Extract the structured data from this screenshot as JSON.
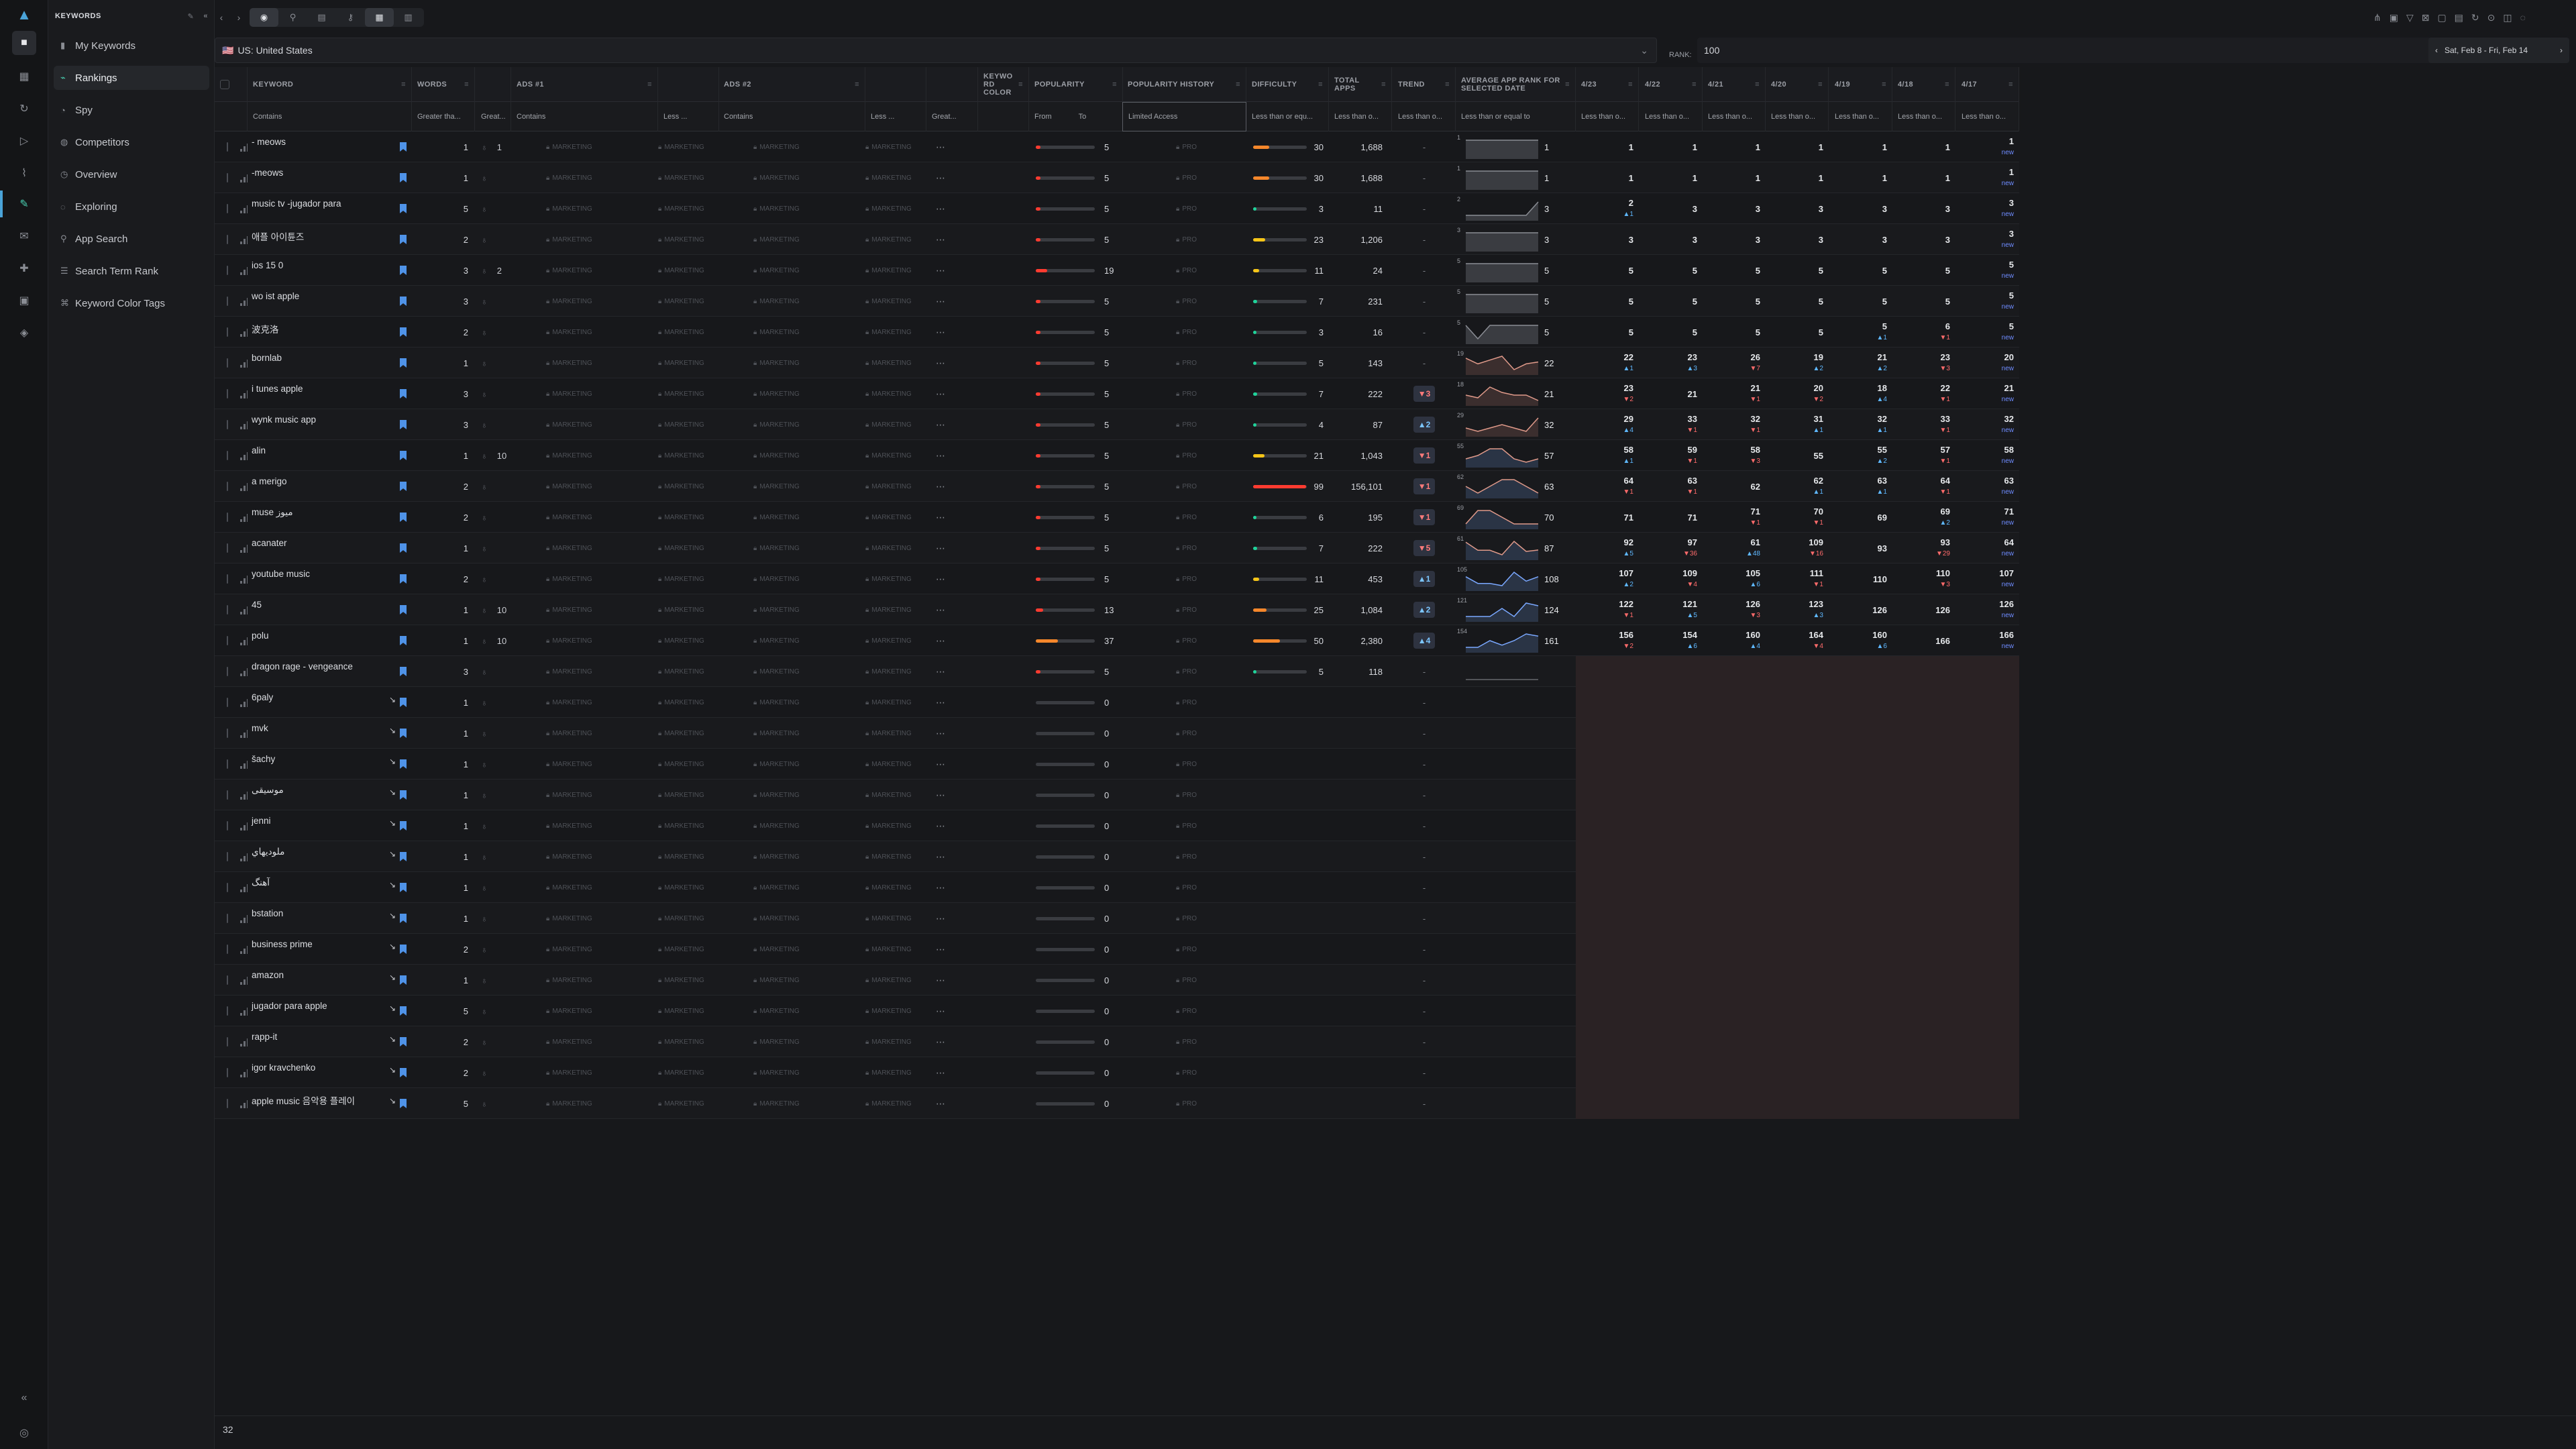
{
  "app": {
    "section": "KEYWORDS"
  },
  "nav": {
    "items": [
      {
        "label": "My Keywords",
        "icon": "bookmark-icon"
      },
      {
        "label": "Rankings",
        "icon": "rankings-icon",
        "selected": true
      },
      {
        "label": "Spy",
        "icon": "spy-icon"
      },
      {
        "label": "Competitors",
        "icon": "competitors-icon"
      },
      {
        "label": "Overview",
        "icon": "overview-icon"
      },
      {
        "label": "Exploring",
        "icon": "exploring-icon"
      },
      {
        "label": "App Search",
        "icon": "search-icon"
      },
      {
        "label": "Search Term Rank",
        "icon": "list-icon"
      },
      {
        "label": "Keyword Color Tags",
        "icon": "tag-icon"
      }
    ]
  },
  "filters": {
    "country": "US: United States",
    "rank_label": "RANK:",
    "rank_value": "100",
    "date_range": "Sat, Feb 8 - Fri, Feb 14"
  },
  "headers": {
    "keyword": "KEYWORD",
    "words": "WORDS",
    "ads1": "ADS #1",
    "ads2": "ADS #2",
    "color": "KEYWO RD COLOR",
    "popularity": "POPULARITY",
    "pop_history": "POPULARITY HISTORY",
    "difficulty": "DIFFICULTY",
    "total_apps": "TOTAL APPS",
    "trend": "TREND",
    "avg_rank": "AVERAGE APP RANK FOR SELECTED DATE",
    "d1": "4/23",
    "d2": "4/22",
    "d3": "4/21",
    "d4": "4/20",
    "d5": "4/19",
    "d6": "4/18",
    "d7": "4/17"
  },
  "subfilters": {
    "keyword": "Contains",
    "words": "Greater tha...",
    "hint": "Great...",
    "ads1": "Contains",
    "ads1b": "Less ...",
    "ads2": "Contains",
    "ads2b": "Less ...",
    "colorb": "Great...",
    "from": "From",
    "to": "To",
    "pop_history": "Limited Access",
    "difficulty": "Less than or equ...",
    "total_apps": "Less than o...",
    "trend": "Less than o...",
    "avg_rank": "Less than or equal to",
    "dates": "Less than o..."
  },
  "labels": {
    "market": "MARKETING",
    "pro": "PRO",
    "new": "new"
  },
  "rows": [
    {
      "kw": "- meows",
      "words": 1,
      "hint": "1",
      "pop": 5,
      "diff": 30,
      "apps": "1,688",
      "trend": "-",
      "avg": "1",
      "spark": "1",
      "r": [
        [
          "1",
          "",
          ""
        ],
        [
          "1",
          "",
          ""
        ],
        [
          "1",
          "",
          ""
        ],
        [
          "1",
          "",
          ""
        ],
        [
          "1",
          "",
          ""
        ],
        [
          "1",
          "",
          ""
        ],
        [
          "1",
          "new",
          "n"
        ]
      ]
    },
    {
      "kw": "-meows",
      "words": 1,
      "hint": "",
      "pop": 5,
      "diff": 30,
      "apps": "1,688",
      "trend": "-",
      "avg": "1",
      "spark": "1",
      "r": [
        [
          "1",
          "",
          ""
        ],
        [
          "1",
          "",
          ""
        ],
        [
          "1",
          "",
          ""
        ],
        [
          "1",
          "",
          ""
        ],
        [
          "1",
          "",
          ""
        ],
        [
          "1",
          "",
          ""
        ],
        [
          "1",
          "new",
          "n"
        ]
      ]
    },
    {
      "kw": "music tv -jugador para",
      "words": 5,
      "hint": "",
      "pop": 5,
      "diff": 3,
      "apps": "11",
      "trend": "-",
      "avg": "3",
      "spark": "2",
      "r": [
        [
          "2",
          "▲1",
          "u"
        ],
        [
          "3",
          "",
          ""
        ],
        [
          "3",
          "",
          ""
        ],
        [
          "3",
          "",
          ""
        ],
        [
          "3",
          "",
          ""
        ],
        [
          "3",
          "",
          ""
        ],
        [
          "3",
          "new",
          "n"
        ]
      ]
    },
    {
      "kw": "애플 아이튠즈",
      "words": 2,
      "hint": "",
      "pop": 5,
      "diff": 23,
      "apps": "1,206",
      "trend": "-",
      "avg": "3",
      "spark": "3",
      "r": [
        [
          "3",
          "",
          ""
        ],
        [
          "3",
          "",
          ""
        ],
        [
          "3",
          "",
          ""
        ],
        [
          "3",
          "",
          ""
        ],
        [
          "3",
          "",
          ""
        ],
        [
          "3",
          "",
          ""
        ],
        [
          "3",
          "new",
          "n"
        ]
      ]
    },
    {
      "kw": "ios 15 0",
      "words": 3,
      "hint": "2",
      "pop": 19,
      "diff": 11,
      "apps": "24",
      "trend": "-",
      "avg": "5",
      "spark": "5",
      "r": [
        [
          "5",
          "",
          ""
        ],
        [
          "5",
          "",
          ""
        ],
        [
          "5",
          "",
          ""
        ],
        [
          "5",
          "",
          ""
        ],
        [
          "5",
          "",
          ""
        ],
        [
          "5",
          "",
          ""
        ],
        [
          "5",
          "new",
          "n"
        ]
      ]
    },
    {
      "kw": "wo ist apple",
      "words": 3,
      "hint": "",
      "pop": 5,
      "diff": 7,
      "apps": "231",
      "trend": "-",
      "avg": "5",
      "spark": "5",
      "r": [
        [
          "5",
          "",
          ""
        ],
        [
          "5",
          "",
          ""
        ],
        [
          "5",
          "",
          ""
        ],
        [
          "5",
          "",
          ""
        ],
        [
          "5",
          "",
          ""
        ],
        [
          "5",
          "",
          ""
        ],
        [
          "5",
          "new",
          "n"
        ]
      ]
    },
    {
      "kw": "波克洛",
      "words": 2,
      "hint": "",
      "pop": 5,
      "diff": 3,
      "apps": "16",
      "trend": "-",
      "avg": "5",
      "spark": "5",
      "r": [
        [
          "5",
          "",
          ""
        ],
        [
          "5",
          "",
          ""
        ],
        [
          "5",
          "",
          ""
        ],
        [
          "5",
          "",
          ""
        ],
        [
          "5",
          "▲1",
          "u"
        ],
        [
          "6",
          "▼1",
          "d"
        ],
        [
          "5",
          "new",
          "n"
        ]
      ]
    },
    {
      "kw": "bornlab",
      "words": 1,
      "hint": "",
      "pop": 5,
      "diff": 5,
      "apps": "143",
      "trend": "-",
      "avg": "22",
      "spark": "19",
      "r": [
        [
          "22",
          "▲1",
          "u"
        ],
        [
          "23",
          "▲3",
          "u"
        ],
        [
          "26",
          "▼7",
          "d"
        ],
        [
          "19",
          "▲2",
          "u"
        ],
        [
          "21",
          "▲2",
          "u"
        ],
        [
          "23",
          "▼3",
          "d"
        ],
        [
          "20",
          "new",
          "n"
        ]
      ]
    },
    {
      "kw": "i tunes apple",
      "words": 3,
      "hint": "",
      "pop": 5,
      "diff": 7,
      "apps": "222",
      "trend": "▼3",
      "avg": "21",
      "spark": "18",
      "r": [
        [
          "23",
          "▼2",
          "d"
        ],
        [
          "21",
          "",
          ""
        ],
        [
          "21",
          "▼1",
          "d"
        ],
        [
          "20",
          "▼2",
          "d"
        ],
        [
          "18",
          "▲4",
          "u"
        ],
        [
          "22",
          "▼1",
          "d"
        ],
        [
          "21",
          "new",
          "n"
        ]
      ]
    },
    {
      "kw": "wynk music app",
      "words": 3,
      "hint": "",
      "pop": 5,
      "diff": 4,
      "apps": "87",
      "trend": "▲2",
      "avg": "32",
      "spark": "29",
      "r": [
        [
          "29",
          "▲4",
          "u"
        ],
        [
          "33",
          "▼1",
          "d"
        ],
        [
          "32",
          "▼1",
          "d"
        ],
        [
          "31",
          "▲1",
          "u"
        ],
        [
          "32",
          "▲1",
          "u"
        ],
        [
          "33",
          "▼1",
          "d"
        ],
        [
          "32",
          "new",
          "n"
        ]
      ]
    },
    {
      "kw": "alin",
      "words": 1,
      "hint": "10",
      "pop": 5,
      "diff": 21,
      "apps": "1,043",
      "trend": "▼1",
      "avg": "57",
      "spark": "55",
      "r": [
        [
          "58",
          "▲1",
          "u"
        ],
        [
          "59",
          "▼1",
          "d"
        ],
        [
          "58",
          "▼3",
          "d"
        ],
        [
          "55",
          "",
          ""
        ],
        [
          "55",
          "▲2",
          "u"
        ],
        [
          "57",
          "▼1",
          "d"
        ],
        [
          "58",
          "new",
          "n"
        ]
      ]
    },
    {
      "kw": "a merigo",
      "words": 2,
      "hint": "",
      "pop": 5,
      "diff": 99,
      "apps": "156,101",
      "trend": "▼1",
      "avg": "63",
      "spark": "62",
      "r": [
        [
          "64",
          "▼1",
          "d"
        ],
        [
          "63",
          "▼1",
          "d"
        ],
        [
          "62",
          "",
          ""
        ],
        [
          "62",
          "▲1",
          "u"
        ],
        [
          "63",
          "▲1",
          "u"
        ],
        [
          "64",
          "▼1",
          "d"
        ],
        [
          "63",
          "new",
          "n"
        ]
      ]
    },
    {
      "kw": "muse ميوز",
      "words": 2,
      "hint": "",
      "pop": 5,
      "diff": 6,
      "apps": "195",
      "trend": "▼1",
      "avg": "70",
      "spark": "69",
      "r": [
        [
          "71",
          "",
          ""
        ],
        [
          "71",
          "",
          ""
        ],
        [
          "71",
          "▼1",
          "d"
        ],
        [
          "70",
          "▼1",
          "d"
        ],
        [
          "69",
          "",
          ""
        ],
        [
          "69",
          "▲2",
          "u"
        ],
        [
          "71",
          "new",
          "n"
        ]
      ]
    },
    {
      "kw": "acanater",
      "words": 1,
      "hint": "",
      "pop": 5,
      "diff": 7,
      "apps": "222",
      "trend": "▼5",
      "avg": "87",
      "spark": "61",
      "r": [
        [
          "92",
          "▲5",
          "u"
        ],
        [
          "97",
          "▼36",
          "d"
        ],
        [
          "61",
          "▲48",
          "u"
        ],
        [
          "109",
          "▼16",
          "d"
        ],
        [
          "93",
          "",
          ""
        ],
        [
          "93",
          "▼29",
          "d"
        ],
        [
          "64",
          "new",
          "n"
        ]
      ]
    },
    {
      "kw": "youtube music",
      "words": 2,
      "hint": "",
      "pop": 5,
      "diff": 11,
      "apps": "453",
      "trend": "▲1",
      "avg": "108",
      "spark": "105",
      "r": [
        [
          "107",
          "▲2",
          "u"
        ],
        [
          "109",
          "▼4",
          "d"
        ],
        [
          "105",
          "▲6",
          "u"
        ],
        [
          "111",
          "▼1",
          "d"
        ],
        [
          "110",
          "",
          ""
        ],
        [
          "110",
          "▼3",
          "d"
        ],
        [
          "107",
          "new",
          "n"
        ]
      ]
    },
    {
      "kw": "45",
      "words": 1,
      "hint": "10",
      "pop": 13,
      "diff": 25,
      "apps": "1,084",
      "trend": "▲2",
      "avg": "124",
      "spark": "121",
      "r": [
        [
          "122",
          "▼1",
          "d"
        ],
        [
          "121",
          "▲5",
          "u"
        ],
        [
          "126",
          "▼3",
          "d"
        ],
        [
          "123",
          "▲3",
          "u"
        ],
        [
          "126",
          "",
          ""
        ],
        [
          "126",
          "",
          ""
        ],
        [
          "126",
          "new",
          "n"
        ]
      ]
    },
    {
      "kw": "polu",
      "words": 1,
      "hint": "10",
      "pop": 37,
      "diff": 50,
      "apps": "2,380",
      "trend": "▲4",
      "avg": "161",
      "spark": "154",
      "r": [
        [
          "156",
          "▼2",
          "d"
        ],
        [
          "154",
          "▲6",
          "u"
        ],
        [
          "160",
          "▲4",
          "u"
        ],
        [
          "164",
          "▼4",
          "d"
        ],
        [
          "160",
          "▲6",
          "u"
        ],
        [
          "166",
          "",
          ""
        ],
        [
          "166",
          "new",
          "n"
        ]
      ]
    },
    {
      "kw": "dragon rage - vengeance",
      "words": 3,
      "hint": "",
      "pop": 5,
      "diff": 5,
      "apps": "118",
      "trend": "-",
      "avg": "",
      "spark": ""
    },
    {
      "kw": "6paly",
      "words": 1,
      "hint": "",
      "pop": 0,
      "trend": "-"
    },
    {
      "kw": "mvk",
      "words": 1,
      "hint": "",
      "pop": 0,
      "trend": "-"
    },
    {
      "kw": "šachy",
      "words": 1,
      "hint": "",
      "pop": 0,
      "trend": "-"
    },
    {
      "kw": "موسيقى",
      "words": 1,
      "hint": "",
      "pop": 0,
      "trend": "-"
    },
    {
      "kw": "jenni",
      "words": 1,
      "hint": "",
      "pop": 0,
      "trend": "-"
    },
    {
      "kw": "ملوديهاي",
      "words": 1,
      "hint": "",
      "pop": 0,
      "trend": "-"
    },
    {
      "kw": "آهنگ",
      "words": 1,
      "hint": "",
      "pop": 0,
      "trend": "-"
    },
    {
      "kw": "bstation",
      "words": 1,
      "hint": "",
      "pop": 0,
      "trend": "-"
    },
    {
      "kw": "business prime",
      "words": 2,
      "hint": "",
      "pop": 0,
      "trend": "-"
    },
    {
      "kw": "amazon",
      "words": 1,
      "hint": "",
      "pop": 0,
      "trend": "-"
    },
    {
      "kw": "jugador para apple",
      "words": 5,
      "hint": "",
      "pop": 0,
      "trend": "-"
    },
    {
      "kw": "rapp-it",
      "words": 2,
      "hint": "",
      "pop": 0,
      "trend": "-"
    },
    {
      "kw": "igor kravchenko",
      "words": 2,
      "hint": "",
      "pop": 0,
      "trend": "-"
    },
    {
      "kw": "apple music 음악용 플레이",
      "words": 5,
      "hint": "",
      "pop": 0,
      "trend": "-"
    }
  ],
  "footer": {
    "count": "32"
  },
  "colors": {
    "accent": "#4ad0b2",
    "bookmark": "#4f93e8",
    "low": "#1fd39a",
    "mid": "#f5c518",
    "high": "#f5872b",
    "veryhigh": "#ff3b30"
  }
}
